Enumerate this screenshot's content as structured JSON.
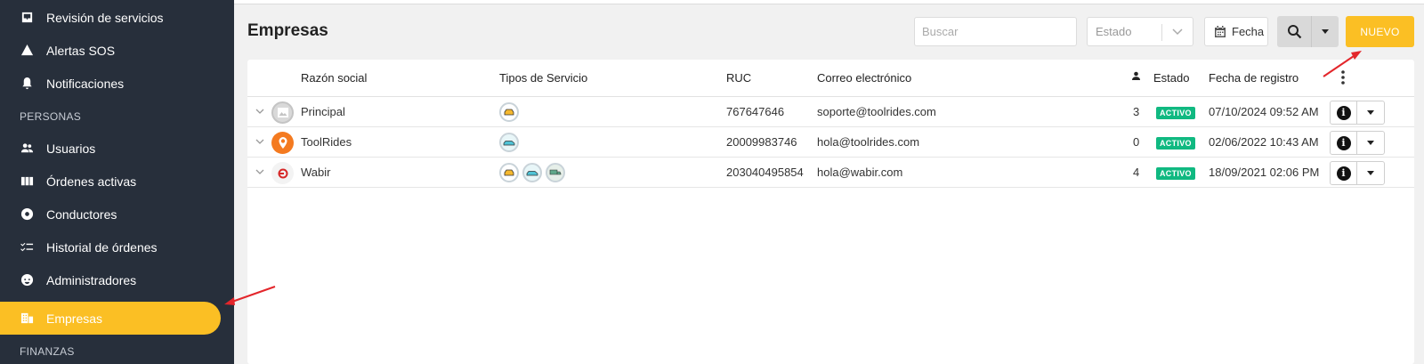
{
  "sidebar": {
    "items": [
      {
        "label": "Revisión de servicios",
        "icon": "inbox-icon"
      },
      {
        "label": "Alertas SOS",
        "icon": "warning-icon"
      },
      {
        "label": "Notificaciones",
        "icon": "bell-icon"
      },
      {
        "label": "Usuarios",
        "icon": "people-icon"
      },
      {
        "label": "Órdenes activas",
        "icon": "map-icon"
      },
      {
        "label": "Conductores",
        "icon": "steering-icon"
      },
      {
        "label": "Historial de órdenes",
        "icon": "checklist-icon"
      },
      {
        "label": "Administradores",
        "icon": "admin-icon"
      },
      {
        "label": "Empresas",
        "icon": "building-icon",
        "active": true
      }
    ],
    "sections": {
      "personas": "PERSONAS",
      "finanzas": "FINANZAS"
    }
  },
  "header": {
    "title": "Empresas",
    "search_placeholder": "Buscar",
    "estado_placeholder": "Estado",
    "fecha_label": "Fecha",
    "nuevo_label": "NUEVO"
  },
  "table": {
    "columns": {
      "razon": "Razón social",
      "tipos": "Tipos de Servicio",
      "ruc": "RUC",
      "correo": "Correo electrónico",
      "estado": "Estado",
      "fecha": "Fecha de registro"
    },
    "rows": [
      {
        "name": "Principal",
        "ruc": "767647646",
        "email": "soporte@toolrides.com",
        "count": "3",
        "estado": "ACTIVO",
        "fecha": "07/10/2024 09:52 AM",
        "avatar": "image-placeholder-icon",
        "services": [
          "taxi-icon"
        ]
      },
      {
        "name": "ToolRides",
        "ruc": "20009983746",
        "email": "hola@toolrides.com",
        "count": "0",
        "estado": "ACTIVO",
        "fecha": "02/06/2022 10:43 AM",
        "avatar": "toolrides-logo",
        "services": [
          "car-icon"
        ]
      },
      {
        "name": "Wabir",
        "ruc": "203040495854",
        "email": "hola@wabir.com",
        "count": "4",
        "estado": "ACTIVO",
        "fecha": "18/09/2021 02:06 PM",
        "avatar": "wabir-logo",
        "services": [
          "taxi-icon",
          "car-icon",
          "truck-icon"
        ]
      }
    ]
  },
  "colors": {
    "accent": "#fbbf24",
    "sidebar_bg": "#272f3b",
    "active_badge": "#10b981",
    "annotation_arrow": "#e3262b"
  }
}
